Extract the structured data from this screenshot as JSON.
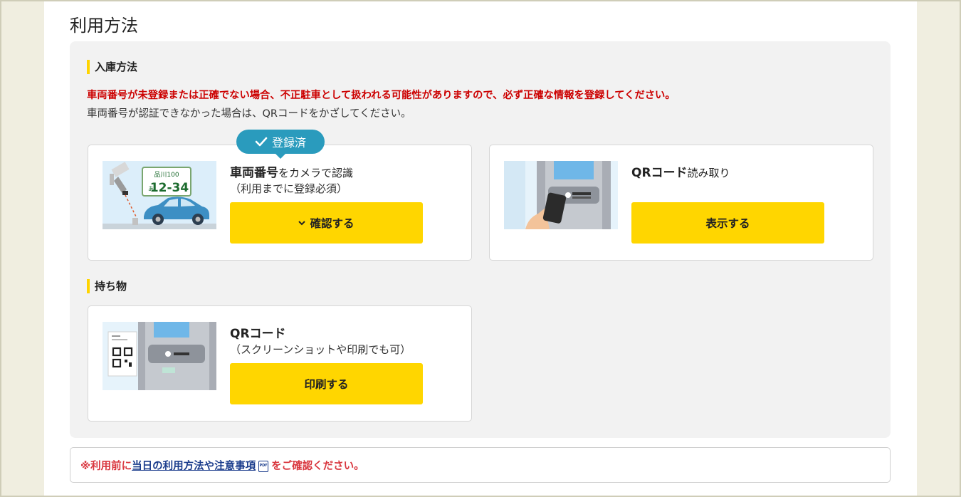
{
  "page": {
    "title": "利用方法"
  },
  "entry": {
    "heading": "入庫方法",
    "warning": "車両番号が未登録または正確でない場合、不正駐車として扱われる可能性がありますので、必ず正確な情報を登録してください。",
    "note": "車両番号が認証できなかった場合は、QRコードをかざしてください。",
    "plate_card": {
      "badge": "登録済",
      "title_bold": "車両番号",
      "title_rest": "をカメラで認識",
      "sub": "（利用までに登録必須）",
      "button": "確認する",
      "plate_top": "品川100",
      "plate_kana": "あ",
      "plate_number": "12-34"
    },
    "qr_card": {
      "title_bold": "QRコード",
      "title_rest": "読み取り",
      "button": "表示する"
    }
  },
  "items": {
    "heading": "持ち物",
    "qr_card": {
      "title_bold": "QRコード",
      "sub": "（スクリーンショットや印刷でも可）",
      "button": "印刷する"
    }
  },
  "notice": {
    "prefix": "※利用前に",
    "link": "当日の利用方法や注意事項",
    "suffix": "をご確認ください。"
  },
  "colors": {
    "accent_yellow": "#ffd600",
    "badge_blue": "#2a9bbd",
    "warning_red": "#cc0000",
    "link_blue": "#1a3c8c"
  }
}
